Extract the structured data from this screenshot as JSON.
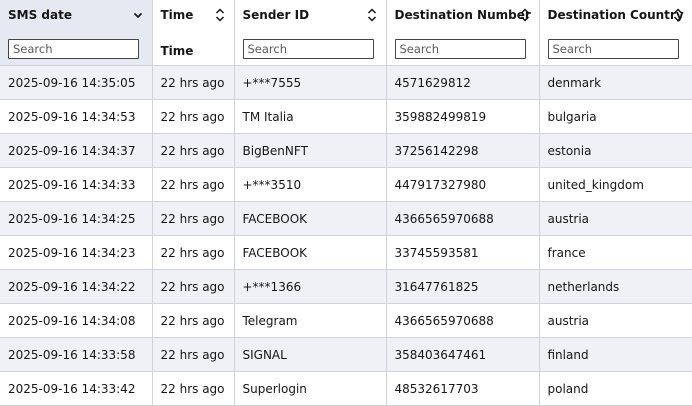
{
  "columns": [
    {
      "label": "SMS date",
      "sort": "chevron-down",
      "filter_placeholder": "Search"
    },
    {
      "label": "Time",
      "sort": "updown",
      "filter_text": "Time"
    },
    {
      "label": "Sender ID",
      "sort": "updown",
      "filter_placeholder": "Search"
    },
    {
      "label": "Destination Number",
      "sort": "updown",
      "filter_placeholder": "Search"
    },
    {
      "label": "Destination Country",
      "sort": "updown",
      "filter_placeholder": "Search"
    }
  ],
  "rows": [
    [
      "2025-09-16 14:35:05",
      "22 hrs ago",
      "+***7555",
      "4571629812",
      "denmark"
    ],
    [
      "2025-09-16 14:34:53",
      "22 hrs ago",
      "TM Italia",
      "359882499819",
      "bulgaria"
    ],
    [
      "2025-09-16 14:34:37",
      "22 hrs ago",
      "BigBenNFT",
      "37256142298",
      "estonia"
    ],
    [
      "2025-09-16 14:34:33",
      "22 hrs ago",
      "+***3510",
      "447917327980",
      "united_kingdom"
    ],
    [
      "2025-09-16 14:34:25",
      "22 hrs ago",
      "FACEBOOK",
      "4366565970688",
      "austria"
    ],
    [
      "2025-09-16 14:34:23",
      "22 hrs ago",
      "FACEBOOK",
      "33745593581",
      "france"
    ],
    [
      "2025-09-16 14:34:22",
      "22 hrs ago",
      "+***1366",
      "31647761825",
      "netherlands"
    ],
    [
      "2025-09-16 14:34:08",
      "22 hrs ago",
      "Telegram",
      "4366565970688",
      "austria"
    ],
    [
      "2025-09-16 14:33:58",
      "22 hrs ago",
      "SIGNAL",
      "358403647461",
      "finland"
    ],
    [
      "2025-09-16 14:33:42",
      "22 hrs ago",
      "Superlogin",
      "48532617703",
      "poland"
    ]
  ]
}
